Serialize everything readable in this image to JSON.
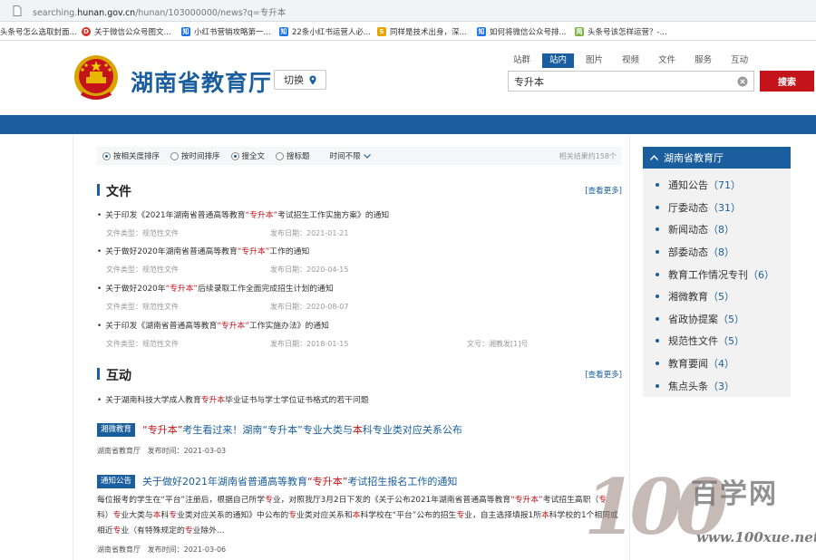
{
  "browser": {
    "url_prefix": "searching.",
    "url_domain": "hunan.gov.cn",
    "url_path": "/hunan/103000000/news?q=专升本",
    "bookmarks": [
      {
        "label": "头条号怎么选取封面...",
        "color": "#e44d26",
        "icon": "doc-icon"
      },
      {
        "label": "关于微信公众号图文...",
        "color": "#d93025",
        "icon": "d-logo-icon"
      },
      {
        "label": "小红书营销攻略第一...",
        "color": "#1a73e8",
        "icon": "zhihu-icon"
      },
      {
        "label": "22条小红书运营人必...",
        "color": "#1a73e8",
        "icon": "zhihu-icon"
      },
      {
        "label": "同样是技术出身，深...",
        "color": "#e8a400",
        "icon": "sohu-icon"
      },
      {
        "label": "如何将微信公众号排...",
        "color": "#1a73e8",
        "icon": "zhihu-icon"
      },
      {
        "label": "头条号该怎样运营？-...",
        "color": "#7cb342",
        "icon": "jianshu-icon"
      }
    ]
  },
  "header": {
    "title": "湖南省教育厅",
    "switch_label": "切换",
    "scope_tabs": [
      "站群",
      "站内",
      "图片",
      "视频",
      "文件",
      "服务",
      "互动"
    ],
    "active_tab": "站内",
    "search_value": "专升本",
    "search_button": "搜索",
    "brand_color": "#1a5e9e",
    "accent_color": "#c4131a"
  },
  "sort_bar": {
    "options": [
      "按相关度排序",
      "按时间排序",
      "搜全文",
      "搜标题"
    ],
    "checked": [
      true,
      false,
      true,
      false
    ],
    "time_filter": "时间不限",
    "result_count": "相关结果约158个"
  },
  "files_section": {
    "title": "文件",
    "more": "[查看更多]",
    "items": [
      {
        "pre": "关于印发《2021年湖南省普通高等教育",
        "hl": "“专升本”",
        "post": "考试招生工作实施方案》的通知",
        "type": "文件类型：规范性文件",
        "date": "发布日期：2021-01-21",
        "docno": ""
      },
      {
        "pre": "关于做好2020年湖南省普通高等教育",
        "hl": "“专升本”",
        "post": "工作的通知",
        "type": "文件类型：规范性文件",
        "date": "发布日期：2020-04-15",
        "docno": ""
      },
      {
        "pre": "关于做好2020年",
        "hl": "“专升本”",
        "post": "后续录取工作全面完成招生计划的通知",
        "type": "文件类型：规范性文件",
        "date": "发布日期：2020-08-07",
        "docno": ""
      },
      {
        "pre": "关于印发《湖南省普通高等教育",
        "hl": "“专升本”",
        "post": "工作实施办法》的通知",
        "type": "文件类型：规范性文件",
        "date": "发布日期：2018-01-15",
        "docno": "文号：湘教发[1]号"
      }
    ]
  },
  "interaction_section": {
    "title": "互动",
    "more": "[查看更多]",
    "item": {
      "pre": "关于湖南科技大学成人教育",
      "hl": "专升本",
      "post": "毕业证书与学士学位证书格式的若干问题"
    }
  },
  "news": [
    {
      "tag": "湘微教育",
      "title": "“专升本”考生看过来！湖南“专升本”专业大类与本科专业类对应关系公布",
      "source": "湖南省教育厅",
      "date": "发布时间：2021-03-03",
      "body": ""
    },
    {
      "tag": "通知公告",
      "title": "关于做好2021年湖南省普通高等教育“专升本”考试招生报名工作的通知",
      "source": "湖南省教育厅",
      "date": "发布时间：2021-03-06",
      "body": "每位报考的学生在“平台”注册后，根据自己所学专业，对照我厅3月2日下发的《关于公布2021年湖南省普通高等教育“专升本”考试招生高职（专科）专业大类与本科专业类对应关系的通知》中公布的专业类对应关系和本科学校在“平台”公布的招生专业，自主选择填报1所本科学校的1个相同或相近专业（有特殊规定的专业除外..."
    }
  ],
  "sidebar": {
    "title": "湖南省教育厅",
    "items": [
      {
        "label": "通知公告",
        "count": "（71）"
      },
      {
        "label": "厅委动态",
        "count": "（31）"
      },
      {
        "label": "新闻动态",
        "count": "（8）"
      },
      {
        "label": "部委动态",
        "count": "（8）"
      },
      {
        "label": "教育工作情况专刊",
        "count": "（6）"
      },
      {
        "label": "湘微教育",
        "count": "（5）"
      },
      {
        "label": "省政协提案",
        "count": "（5）"
      },
      {
        "label": "规范性文件",
        "count": "（5）"
      },
      {
        "label": "教育要闻",
        "count": "（4）"
      },
      {
        "label": "焦点头条",
        "count": "（3）"
      }
    ]
  },
  "watermark": {
    "number": "100",
    "text": "百学网",
    "url": "www.100xue.net"
  }
}
